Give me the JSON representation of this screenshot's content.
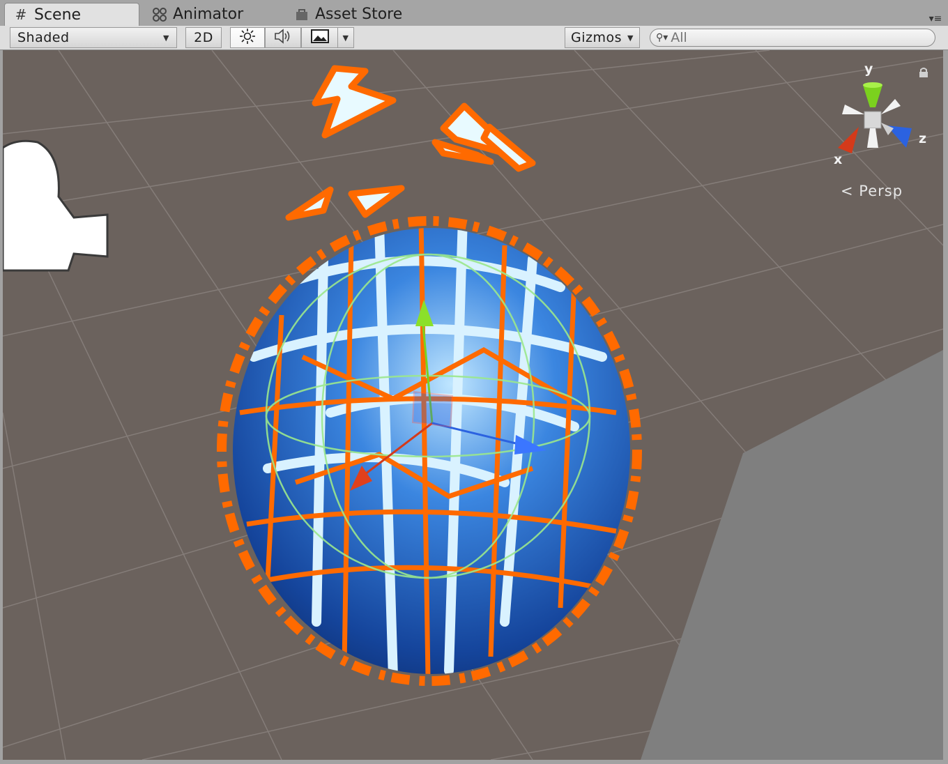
{
  "tabs": [
    {
      "label": "Scene",
      "icon": "grid-icon",
      "active": true
    },
    {
      "label": "Animator",
      "icon": "animator-icon",
      "active": false
    },
    {
      "label": "Asset Store",
      "icon": "store-icon",
      "active": false
    }
  ],
  "toolbar": {
    "draw_mode": "Shaded",
    "mode_2d": "2D",
    "lighting_icon": "sun-icon",
    "audio_icon": "speaker-icon",
    "effects_icon": "image-icon",
    "gizmos_label": "Gizmos",
    "search_placeholder": "All"
  },
  "viewport": {
    "projection_label": "Persp",
    "axis_labels": {
      "y": "y",
      "z": "z",
      "x": "x"
    },
    "selected_object": "fractured-sphere",
    "colors": {
      "ground": "#6b625d",
      "grid": "#8a8280",
      "selection_outline": "#ff6a00",
      "sphere": "#2a6fd0",
      "axis_x": "#d43a1a",
      "axis_y": "#7bd11e",
      "axis_z": "#2b62e0"
    }
  }
}
